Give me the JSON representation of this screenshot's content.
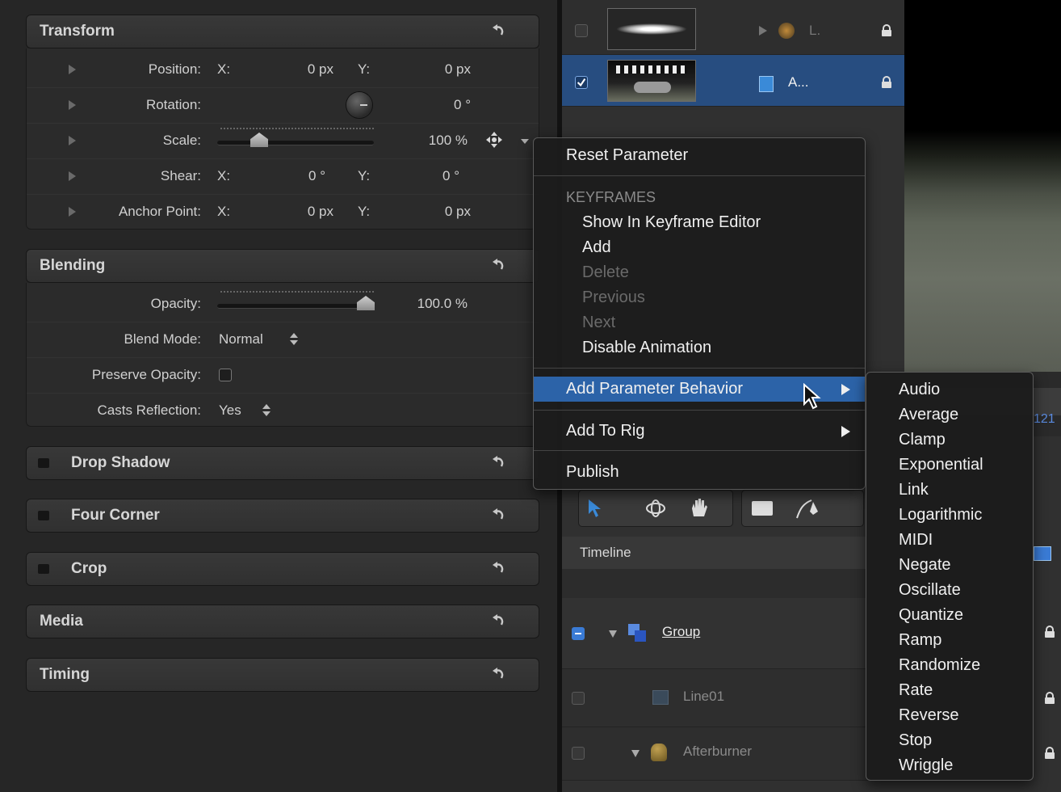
{
  "inspector": {
    "transform": {
      "title": "Transform",
      "position": {
        "label": "Position:",
        "x_label": "X:",
        "x_value": "0 px",
        "y_label": "Y:",
        "y_value": "0 px"
      },
      "rotation": {
        "label": "Rotation:",
        "value": "0 °"
      },
      "scale": {
        "label": "Scale:",
        "value": "100 %"
      },
      "shear": {
        "label": "Shear:",
        "x_label": "X:",
        "x_value": "0 °",
        "y_label": "Y:",
        "y_value": "0 °"
      },
      "anchor": {
        "label": "Anchor Point:",
        "x_label": "X:",
        "x_value": "0 px",
        "y_label": "Y:",
        "y_value": "0 px"
      }
    },
    "blending": {
      "title": "Blending",
      "opacity": {
        "label": "Opacity:",
        "value": "100.0 %",
        "level": 1.0
      },
      "blend_mode": {
        "label": "Blend Mode:",
        "value": "Normal"
      },
      "preserve_opacity": {
        "label": "Preserve Opacity:",
        "checked": false
      },
      "casts_reflection": {
        "label": "Casts Reflection:",
        "value": "Yes"
      }
    },
    "drop_shadow": {
      "title": "Drop Shadow"
    },
    "four_corner": {
      "title": "Four Corner"
    },
    "crop": {
      "title": "Crop"
    },
    "media": {
      "title": "Media"
    },
    "timing": {
      "title": "Timing"
    }
  },
  "layers": {
    "top_rows": [
      {
        "name": "L.",
        "checked": false
      },
      {
        "name": "A...",
        "checked": true
      }
    ],
    "timeline_label": "Timeline",
    "tree": [
      {
        "name": "Group"
      },
      {
        "name": "Line01"
      },
      {
        "name": "Afterburner"
      }
    ],
    "partial_number": "121"
  },
  "context_menu": {
    "reset": "Reset Parameter",
    "keyframes_header": "KEYFRAMES",
    "show_in_editor": "Show In Keyframe Editor",
    "add": "Add",
    "delete": "Delete",
    "previous": "Previous",
    "next": "Next",
    "disable_animation": "Disable Animation",
    "add_behavior": "Add Parameter Behavior",
    "add_to_rig": "Add To Rig",
    "publish": "Publish"
  },
  "submenu": {
    "items": [
      "Audio",
      "Average",
      "Clamp",
      "Exponential",
      "Link",
      "Logarithmic",
      "MIDI",
      "Negate",
      "Oscillate",
      "Quantize",
      "Ramp",
      "Randomize",
      "Rate",
      "Reverse",
      "Stop",
      "Wriggle"
    ]
  },
  "colors": {
    "highlight": "#2c63a8",
    "check_blue": "#3a7bd5"
  }
}
